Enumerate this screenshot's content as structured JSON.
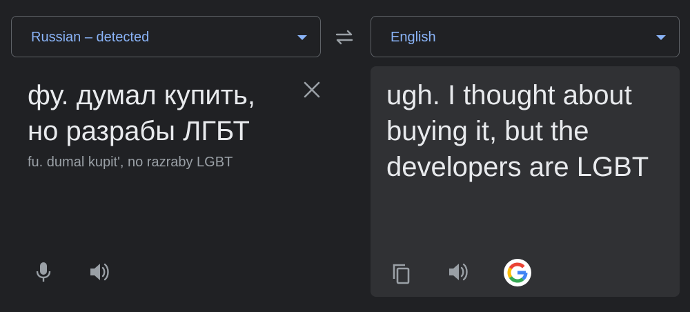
{
  "source_lang": {
    "label": "Russian – detected",
    "icon": "chevron-down-icon"
  },
  "target_lang": {
    "label": "English",
    "icon": "chevron-down-icon"
  },
  "swap": {
    "icon": "swap-arrows-icon"
  },
  "source": {
    "text": "фу. думал купить,\nно разрабы ЛГБТ",
    "transliteration": "fu. dumal kupit', no razraby LGBT",
    "clear_icon": "close-icon",
    "mic_icon": "microphone-icon",
    "listen_icon": "speaker-icon"
  },
  "target": {
    "text": "ugh. I thought about buying it, but the developers are LGBT",
    "copy_icon": "copy-icon",
    "listen_icon": "speaker-icon",
    "google_icon": "google-logo-icon"
  },
  "colors": {
    "background": "#202124",
    "target_panel": "#303134",
    "border": "#5f6368",
    "accent": "#8ab4f8",
    "text": "#e8eaed",
    "muted_text": "#9aa0a6",
    "icon": "#9aa0a6"
  }
}
